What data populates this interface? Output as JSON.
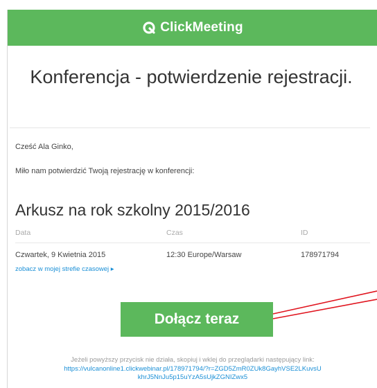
{
  "header": {
    "brand": "ClickMeeting",
    "color": "#5cb85c"
  },
  "title": "Konferencja - potwierdzenie rejestracji.",
  "greeting": "Cześć Ala Ginko,",
  "intro": "Miło nam potwierdzić Twoją rejestrację w konferencji:",
  "event": {
    "title": "Arkusz na rok szkolny 2015/2016",
    "columns": {
      "date": "Data",
      "time": "Czas",
      "id": "ID"
    },
    "date": "Czwartek, 9 Kwietnia 2015",
    "time": "12:30 Europe/Warsaw",
    "id": "178971794",
    "timezone_link": "zobacz w mojej strefie czasowej ▸"
  },
  "join_button": "Dołącz teraz",
  "footer": {
    "note": "Jeżeli powyższy przycisk nie działa, skopiuj i wklej do przeglądarki następujący link:",
    "link_line1": "https://vulcanonline1.clickwebinar.pl/178971794/?r=ZGD5ZmR0ZUk8GayhVSE2LKuvsU",
    "link_line2": "khrJ5NnJu5p15uYzA5sUjkZGNIZwx5"
  },
  "colors": {
    "accent": "#5cb85c",
    "link": "#1a8fd6",
    "annotation_arrow": "#e0141e"
  }
}
